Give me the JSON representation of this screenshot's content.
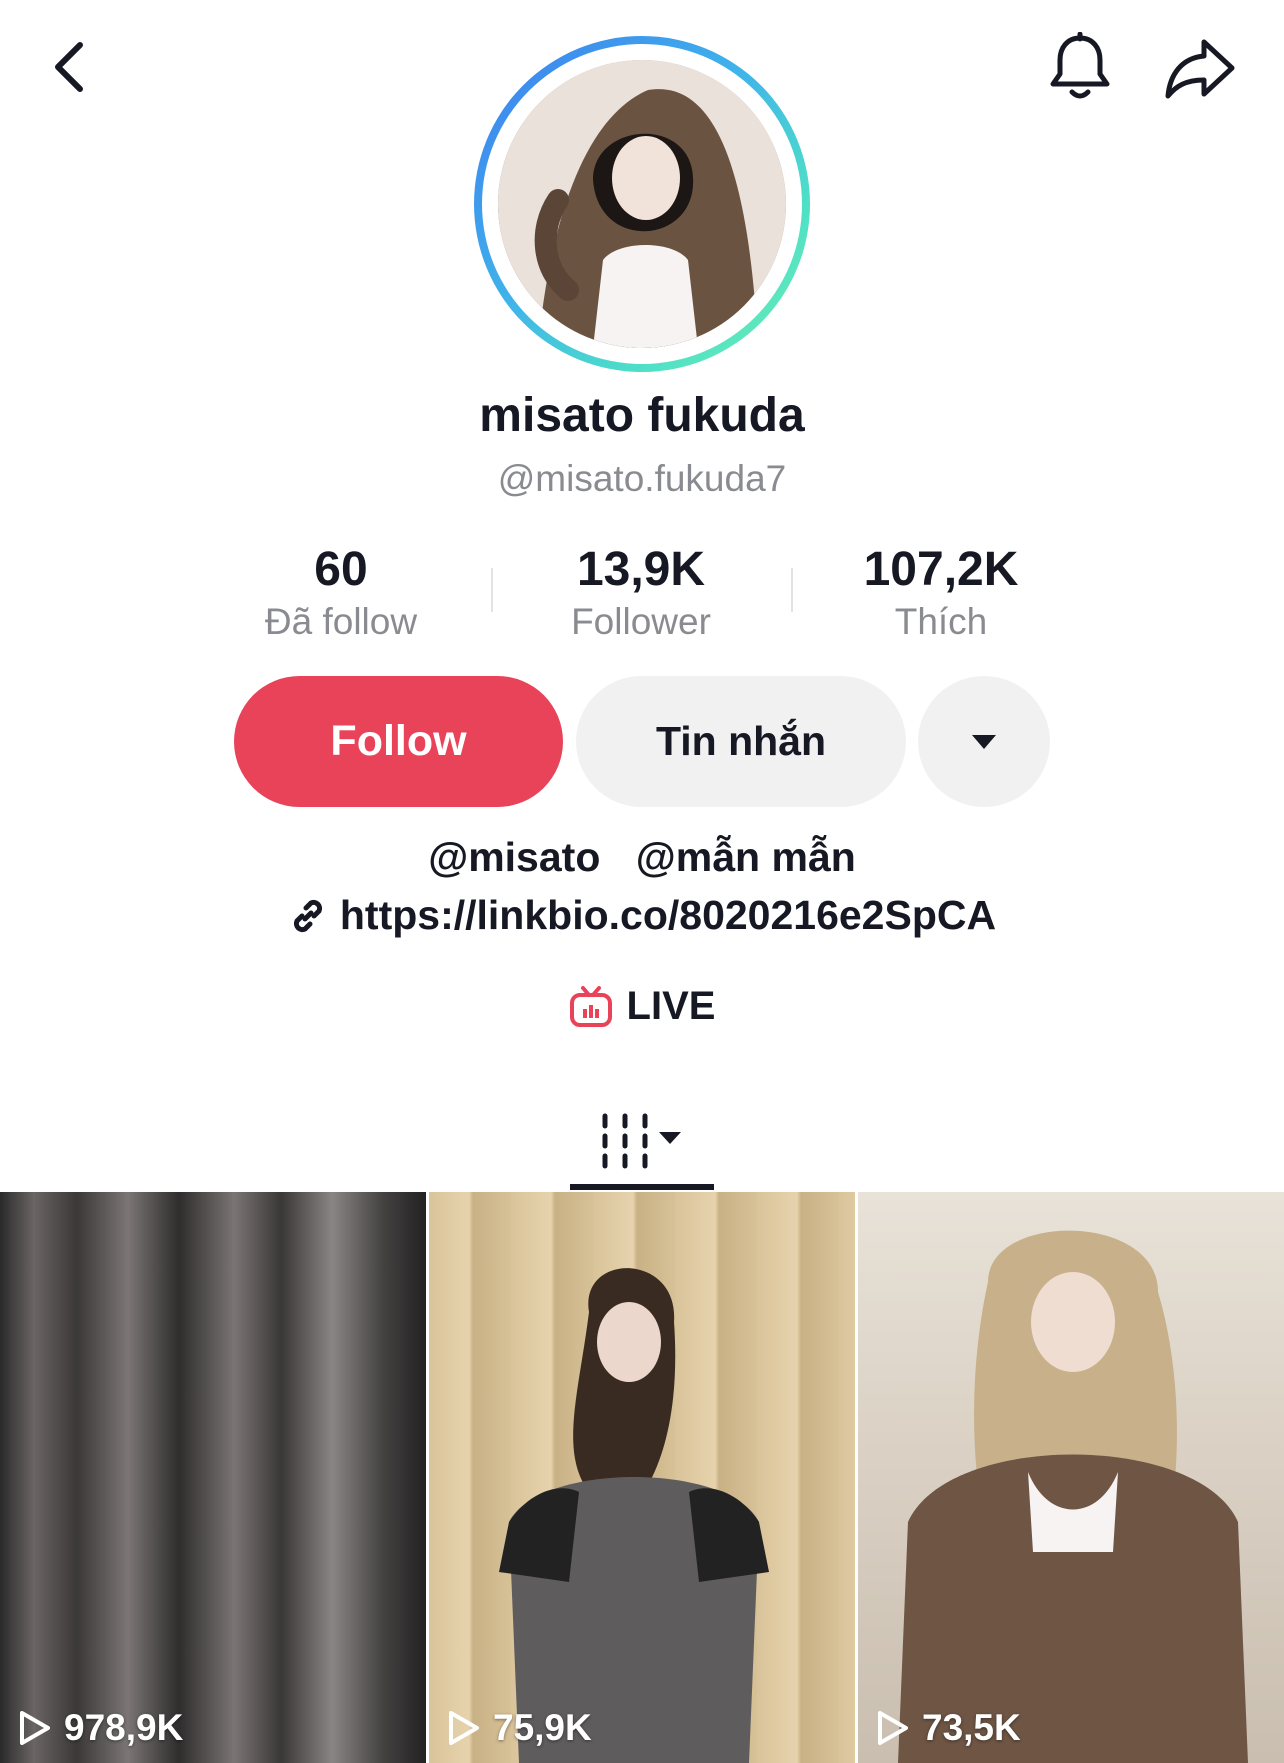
{
  "profile": {
    "display_name": "misato fukuda",
    "handle": "@misato.fukuda7"
  },
  "stats": {
    "following": {
      "value": "60",
      "label": "Đã follow"
    },
    "followers": {
      "value": "13,9K",
      "label": "Follower"
    },
    "likes": {
      "value": "107,2K",
      "label": "Thích"
    }
  },
  "actions": {
    "follow_label": "Follow",
    "message_label": "Tin nhắn"
  },
  "bio": {
    "mentions": [
      "@misato",
      "@mẫn mẫn"
    ],
    "link": "https://linkbio.co/8020216e2SpCA"
  },
  "live": {
    "label": "LIVE"
  },
  "videos": [
    {
      "views": "978,9K"
    },
    {
      "views": "75,9K"
    },
    {
      "views": "73,5K"
    }
  ],
  "colors": {
    "accent": "#e9435a",
    "live_icon": "#e9435a",
    "text_primary": "#161823",
    "text_secondary": "#8a8b91",
    "button_secondary": "#f1f1f2"
  },
  "icons": {
    "back": "chevron-left-icon",
    "notifications": "bell-icon",
    "share": "share-arrow-icon",
    "more": "caret-down-icon",
    "link": "link-icon",
    "live": "live-tv-icon",
    "grid": "grid-icon",
    "play": "play-icon"
  }
}
